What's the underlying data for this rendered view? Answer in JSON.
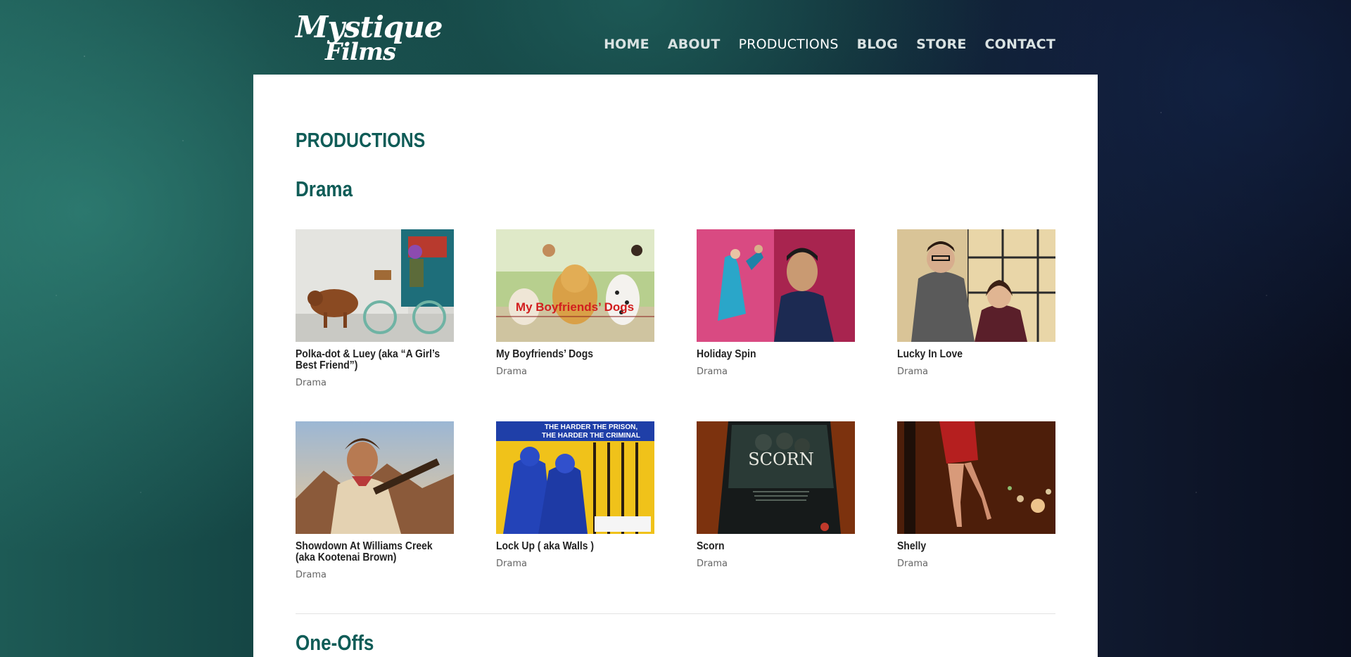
{
  "site": {
    "logo_line1": "Mystique",
    "logo_line2": "Films"
  },
  "nav": {
    "items": [
      {
        "label": "HOME"
      },
      {
        "label": "ABOUT"
      },
      {
        "label": "PRODUCTIONS"
      },
      {
        "label": "BLOG"
      },
      {
        "label": "STORE"
      },
      {
        "label": "CONTACT"
      }
    ],
    "active": "PRODUCTIONS"
  },
  "page": {
    "title": "PRODUCTIONS"
  },
  "sections": [
    {
      "title": "Drama",
      "items": [
        {
          "title": "Polka-dot & Luey (aka “A Girl’s Best Friend”)",
          "category": "Drama",
          "thumb": "girl-bicycle-bloodhound"
        },
        {
          "title": "My Boyfriends’ Dogs",
          "category": "Drama",
          "thumb": "dogs-poster",
          "thumb_text": "My Boyfriends’ Dogs"
        },
        {
          "title": "Holiday Spin",
          "category": "Drama",
          "thumb": "dancers-man-portrait"
        },
        {
          "title": "Lucky In Love",
          "category": "Drama",
          "thumb": "couple-window"
        },
        {
          "title": "Showdown At Williams Creek (aka Kootenai Brown)",
          "category": "Drama",
          "thumb": "man-rifle-mountains"
        },
        {
          "title": "Lock Up ( aka Walls )",
          "category": "Drama",
          "thumb": "prison-poster",
          "thumb_text_1": "THE HARDER THE PRISON,",
          "thumb_text_2": "THE HARDER THE CRIMINAL"
        },
        {
          "title": "Scorn",
          "category": "Drama",
          "thumb": "dvd-cover",
          "thumb_text": "SCORN"
        },
        {
          "title": "Shelly",
          "category": "Drama",
          "thumb": "woman-red-dress-night"
        }
      ]
    },
    {
      "title": "One-Offs",
      "items": []
    }
  ],
  "colors": {
    "accent": "#0f5c57",
    "text": "#222222",
    "muted": "#666666"
  }
}
